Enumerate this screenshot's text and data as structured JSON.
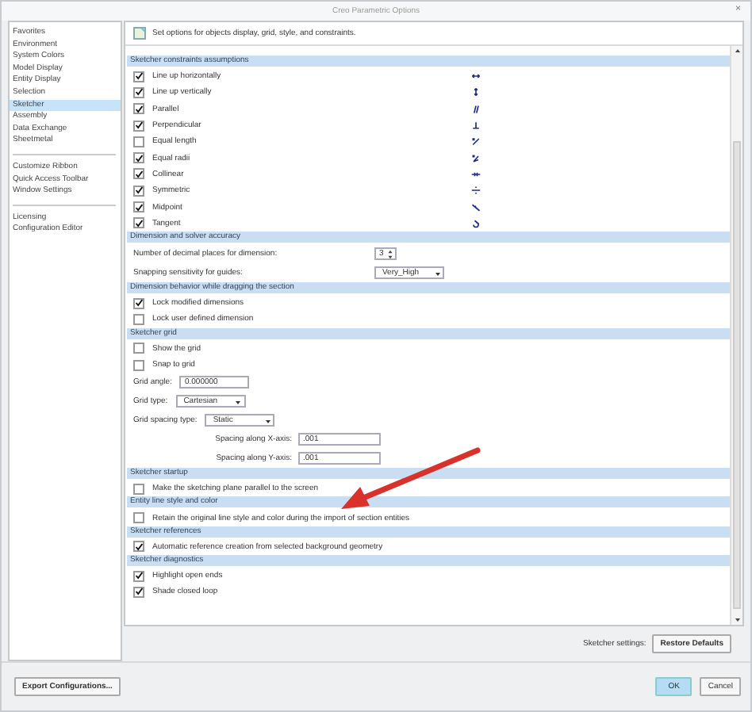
{
  "window": {
    "title": "Creo Parametric Options",
    "close": "×"
  },
  "sidebar": {
    "groups": [
      [
        {
          "label": "Favorites",
          "selected": false
        },
        {
          "label": "Environment",
          "selected": false
        },
        {
          "label": "System Colors",
          "selected": false
        },
        {
          "label": "Model Display",
          "selected": false
        },
        {
          "label": "Entity Display",
          "selected": false
        },
        {
          "label": "Selection",
          "selected": false
        },
        {
          "label": "Sketcher",
          "selected": true
        },
        {
          "label": "Assembly",
          "selected": false
        },
        {
          "label": "Data Exchange",
          "selected": false
        },
        {
          "label": "Sheetmetal",
          "selected": false
        }
      ],
      [
        {
          "label": "Customize Ribbon",
          "selected": false
        },
        {
          "label": "Quick Access Toolbar",
          "selected": false
        },
        {
          "label": "Window Settings",
          "selected": false
        }
      ],
      [
        {
          "label": "Licensing",
          "selected": false
        },
        {
          "label": "Configuration Editor",
          "selected": false
        }
      ]
    ]
  },
  "header": "Set options for objects display, grid, style, and constraints.",
  "sections": [
    {
      "title": "Sketcher constraints assumptions",
      "rows": [
        {
          "kind": "constraint",
          "label": "Line up horizontally",
          "checked": true
        },
        {
          "kind": "constraint",
          "label": "Line up vertically",
          "checked": true
        },
        {
          "kind": "constraint",
          "label": "Parallel",
          "checked": true
        },
        {
          "kind": "constraint",
          "label": "Perpendicular",
          "checked": true
        },
        {
          "kind": "constraint",
          "label": "Equal length",
          "checked": false
        },
        {
          "kind": "constraint",
          "label": "Equal radii",
          "checked": true
        },
        {
          "kind": "constraint",
          "label": "Collinear",
          "checked": true
        },
        {
          "kind": "constraint",
          "label": "Symmetric",
          "checked": true
        },
        {
          "kind": "constraint",
          "label": "Midpoint",
          "checked": true
        },
        {
          "kind": "constraint",
          "label": "Tangent",
          "checked": true
        }
      ]
    },
    {
      "title": "Dimension and solver accuracy",
      "aligned": true,
      "rows": [
        {
          "kind": "spinner",
          "label": "Number of decimal places for dimension:",
          "value": "3"
        },
        {
          "kind": "select",
          "label": "Snapping sensitivity for guides:",
          "value": "Very_High"
        }
      ]
    },
    {
      "title": "Dimension behavior while dragging the section",
      "rows": [
        {
          "kind": "checkbox",
          "label": "Lock modified dimensions",
          "checked": true
        },
        {
          "kind": "checkbox",
          "label": "Lock user defined dimension",
          "checked": false
        }
      ]
    },
    {
      "title": "Sketcher grid",
      "rows": [
        {
          "kind": "checkbox",
          "label": "Show the grid",
          "checked": false
        },
        {
          "kind": "checkbox",
          "label": "Snap to grid",
          "checked": false
        },
        {
          "kind": "text",
          "label": "Grid angle:",
          "value": "0.000000"
        },
        {
          "kind": "select",
          "label": "Grid type:",
          "value": "Cartesian"
        },
        {
          "kind": "select",
          "label": "Grid spacing type:",
          "value": "Static"
        },
        {
          "kind": "subfield",
          "label": "Spacing along X-axis:",
          "value": ".001"
        },
        {
          "kind": "subfield",
          "label": "Spacing along Y-axis:",
          "value": ".001"
        }
      ]
    },
    {
      "title": "Sketcher startup",
      "rows": [
        {
          "kind": "checkbox",
          "label": "Make the sketching plane parallel to the screen",
          "checked": false
        }
      ]
    },
    {
      "title": "Entity line style and color",
      "rows": [
        {
          "kind": "checkbox",
          "label": "Retain the original line style and color during the import of section entities",
          "checked": false
        }
      ]
    },
    {
      "title": "Sketcher references",
      "rows": [
        {
          "kind": "checkbox",
          "label": "Automatic reference creation from selected background geometry",
          "checked": true
        }
      ]
    },
    {
      "title": "Sketcher diagnostics",
      "rows": [
        {
          "kind": "checkbox",
          "label": "Highlight open ends",
          "checked": true
        },
        {
          "kind": "checkbox",
          "label": "Shade closed loop",
          "checked": true
        }
      ]
    }
  ],
  "footer": {
    "label": "Sketcher settings:",
    "button": "Restore Defaults"
  },
  "buttons": {
    "export": "Export Configurations...",
    "ok": "OK",
    "cancel": "Cancel"
  }
}
